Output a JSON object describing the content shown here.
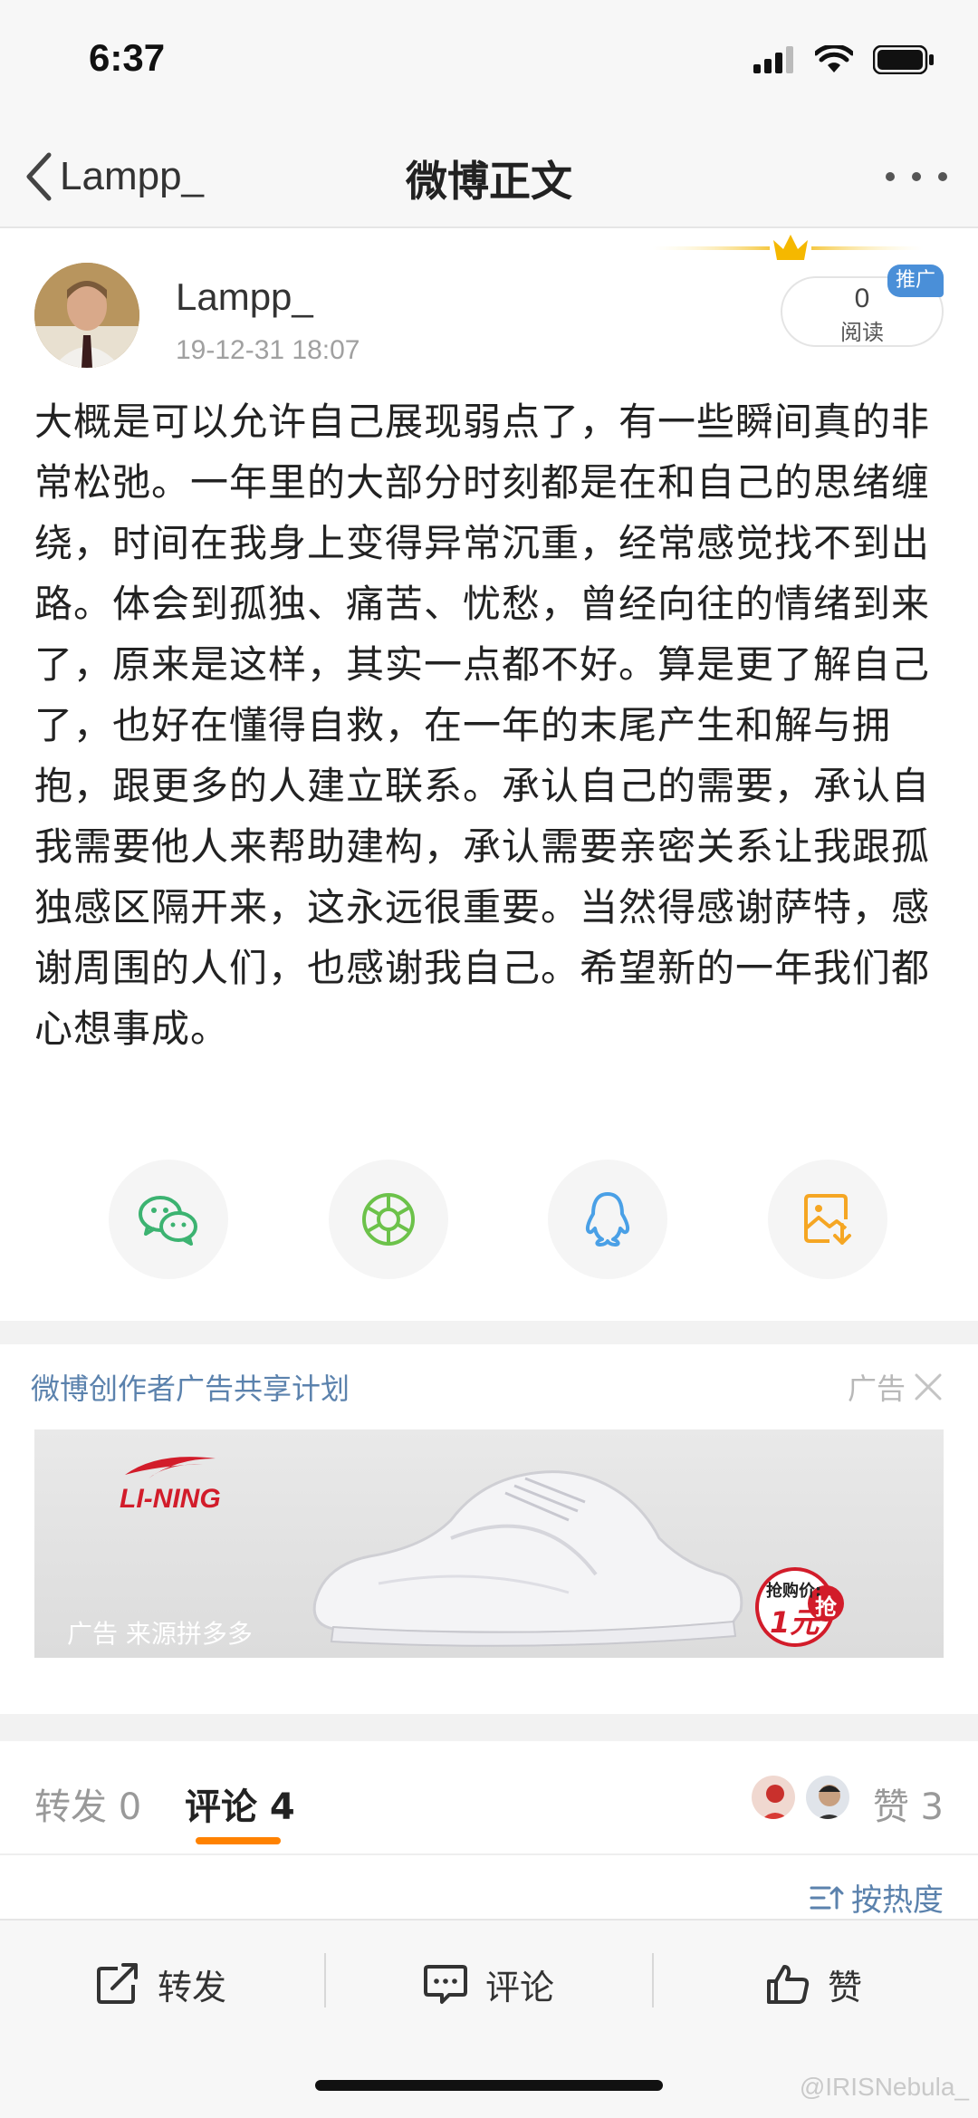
{
  "status_bar": {
    "time": "6:37"
  },
  "nav": {
    "back_label": "Lampp_",
    "title": "微博正文"
  },
  "post": {
    "author": "Lampp_",
    "time": "19-12-31 18:07",
    "reads_count": "0",
    "reads_label": "阅读",
    "promo_badge": "推广",
    "body": "大概是可以允许自己展现弱点了，有一些瞬间真的非常松弛。一年里的大部分时刻都是在和自己的思绪缠绕，时间在我身上变得异常沉重，经常感觉找不到出路。体会到孤独、痛苦、忧愁，曾经向往的情绪到来了，原来是这样，其实一点都不好。算是更了解自己了，也好在懂得自救，在一年的末尾产生和解与拥抱，跟更多的人建立联系。承认自己的需要，承认自我需要他人来帮助建构，承认需要亲密关系让我跟孤独感区隔开来，这永远很重要。当然得感谢萨特，感谢周围的人们，也感谢我自己。希望新的一年我们都心想事成。"
  },
  "share": {
    "icons": [
      "wechat-icon",
      "moments-icon",
      "qq-icon",
      "save-image-icon"
    ],
    "colors": {
      "wechat": "#3cb371",
      "moments": "#6cc24a",
      "qq": "#4aa0e6",
      "save": "#f5a623"
    }
  },
  "ad": {
    "header": "微博创作者广告共享计划",
    "label": "广告",
    "brand": "LI-NING",
    "source": "广告 来源拼多多",
    "price_tag": "抢购价:",
    "price_value": "1元",
    "price_action": "抢"
  },
  "tabs": {
    "repost": "转发 0",
    "comments": "评论 4",
    "likes": "赞 3"
  },
  "sort": {
    "label": "按热度"
  },
  "bottom_bar": {
    "repost": "转发",
    "comment": "评论",
    "like": "赞"
  },
  "watermark": "@IRISNebula_",
  "colors": {
    "accent": "#ff8200",
    "link": "#5b82ad",
    "muted": "#a0a0a0"
  }
}
